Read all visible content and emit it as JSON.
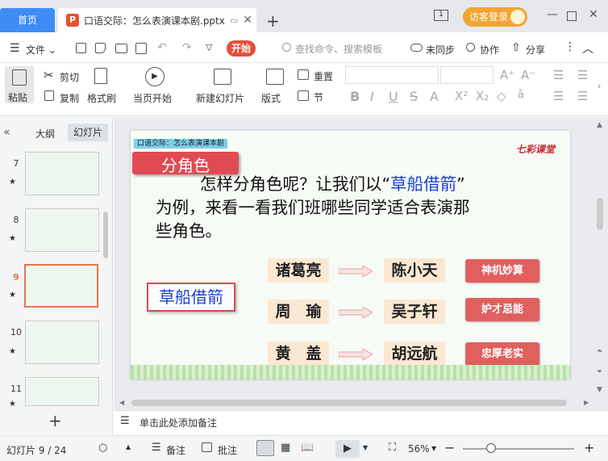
{
  "tabs": {
    "home": "首页",
    "doc": "口语交际：怎么表演课本剧.pptx"
  },
  "titlebar": {
    "login": "访客登录"
  },
  "menu": {
    "file": "文件",
    "start": "开始",
    "search_placeholder": "查找命令、搜索模板",
    "unsync": "未同步",
    "collab": "协作",
    "share": "分享"
  },
  "ribbon": {
    "paste": "粘贴",
    "cut": "剪切",
    "copy": "复制",
    "format_painter": "格式刷",
    "from_start": "当页开始",
    "new_slide": "新建幻灯片",
    "layout": "版式",
    "reset": "重置",
    "section": "节"
  },
  "panel": {
    "outline": "大纲",
    "slides": "幻灯片",
    "thumb_numbers": [
      "7",
      "8",
      "9",
      "10",
      "11"
    ],
    "selected": "9"
  },
  "slide": {
    "header": "口语交际：怎么表演课本剧",
    "logo": "七彩课堂",
    "title": "分角色",
    "body_pre": "怎样分角色呢？让我们以“",
    "body_highlight": "草船借箭",
    "body_post_line1": "”",
    "body_line2": "为例，来看一看我们班哪些同学适合表演那",
    "body_line3": "些角色。",
    "story": "草船借箭",
    "rows": [
      {
        "role": "诸葛亮",
        "student": "陈小天",
        "trait": "神机妙算"
      },
      {
        "role": "周　瑜",
        "student": "吴子轩",
        "trait": "妒才忌能"
      },
      {
        "role": "黄　盖",
        "student": "胡远航",
        "trait": "忠厚老实"
      }
    ]
  },
  "notes": {
    "placeholder": "单击此处添加备注"
  },
  "status": {
    "slide_count": "幻灯片 9 / 24",
    "notes_btn": "备注",
    "comment_btn": "批注",
    "zoom": "56%",
    "zoom_fraction": 0.56
  },
  "colors": {
    "accent_blue": "#3f8cf5",
    "start_red": "#e54e3a",
    "highlight_blue": "#1a3fd0",
    "trait_red": "#e06060"
  }
}
